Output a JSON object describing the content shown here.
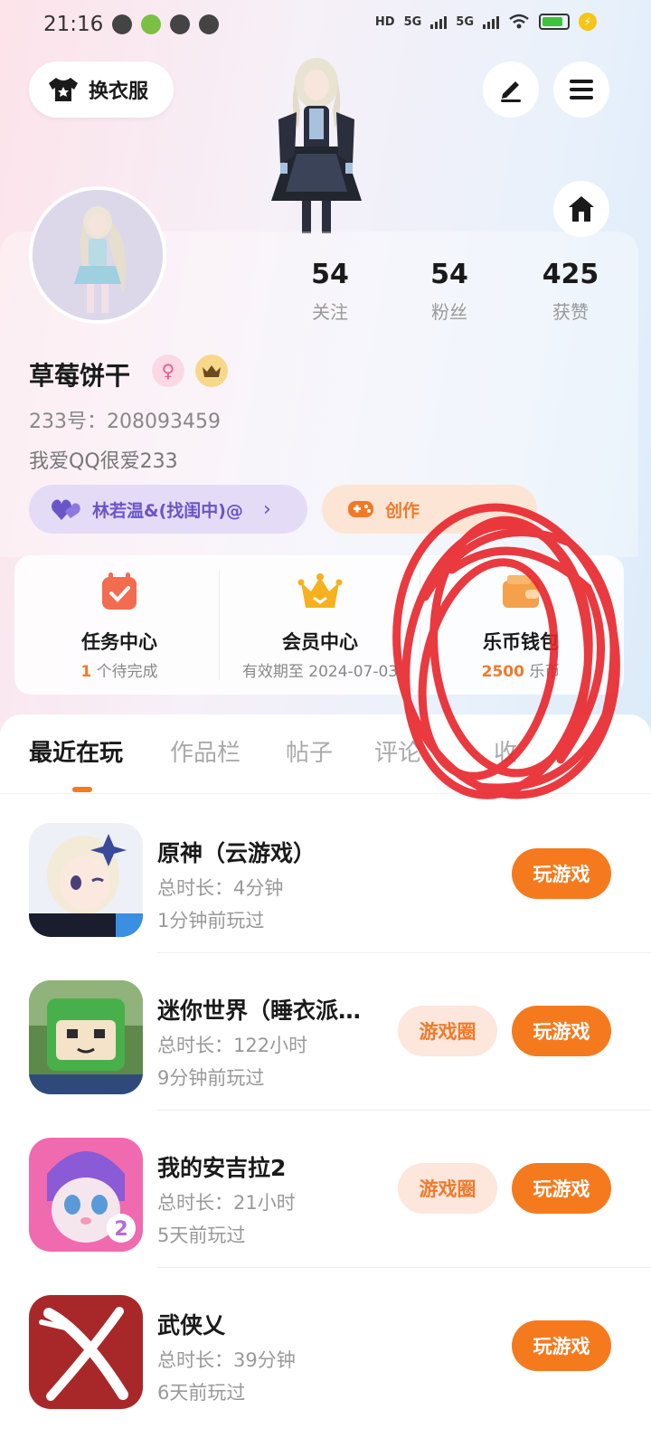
{
  "status_bar": {
    "time": "21:16",
    "network_1": "5G",
    "network_2": "5G",
    "hd": "HD"
  },
  "top": {
    "outfit_label": "换衣服"
  },
  "stats": [
    {
      "num": "54",
      "label": "关注"
    },
    {
      "num": "54",
      "label": "粉丝"
    },
    {
      "num": "425",
      "label": "获赞"
    }
  ],
  "profile": {
    "username": "草莓饼干",
    "user_id": "233号：208093459",
    "bio": "我爱QQ很爱233"
  },
  "chips": {
    "relation": "林若温&(找闺中)@",
    "creator": "创作"
  },
  "quick": [
    {
      "title": "任务中心",
      "sub_hl": "1",
      "sub": " 个待完成"
    },
    {
      "title": "会员中心",
      "sub_hl": "",
      "sub": "有效期至 2024-07-03"
    },
    {
      "title": "乐币钱包",
      "sub_hl": "2500",
      "sub": " 乐币"
    }
  ],
  "tabs": [
    "最近在玩",
    "作品栏",
    "帖子",
    "评论",
    "收"
  ],
  "games": [
    {
      "name": "原神（云游戏）",
      "duration": "总时长：4分钟",
      "last": "1分钟前玩过",
      "circle": "",
      "play": "玩游戏"
    },
    {
      "name": "迷你世界（睡衣派…",
      "duration": "总时长：122小时",
      "last": "9分钟前玩过",
      "circle": "游戏圈",
      "play": "玩游戏"
    },
    {
      "name": "我的安吉拉2",
      "duration": "总时长：21小时",
      "last": "5天前玩过",
      "circle": "游戏圈",
      "play": "玩游戏"
    },
    {
      "name": "武侠乂",
      "duration": "总时长：39分钟",
      "last": "6天前玩过",
      "circle": "",
      "play": "玩游戏"
    }
  ],
  "colors": {
    "accent": "#f57a1e",
    "annotation": "#e8252b"
  }
}
